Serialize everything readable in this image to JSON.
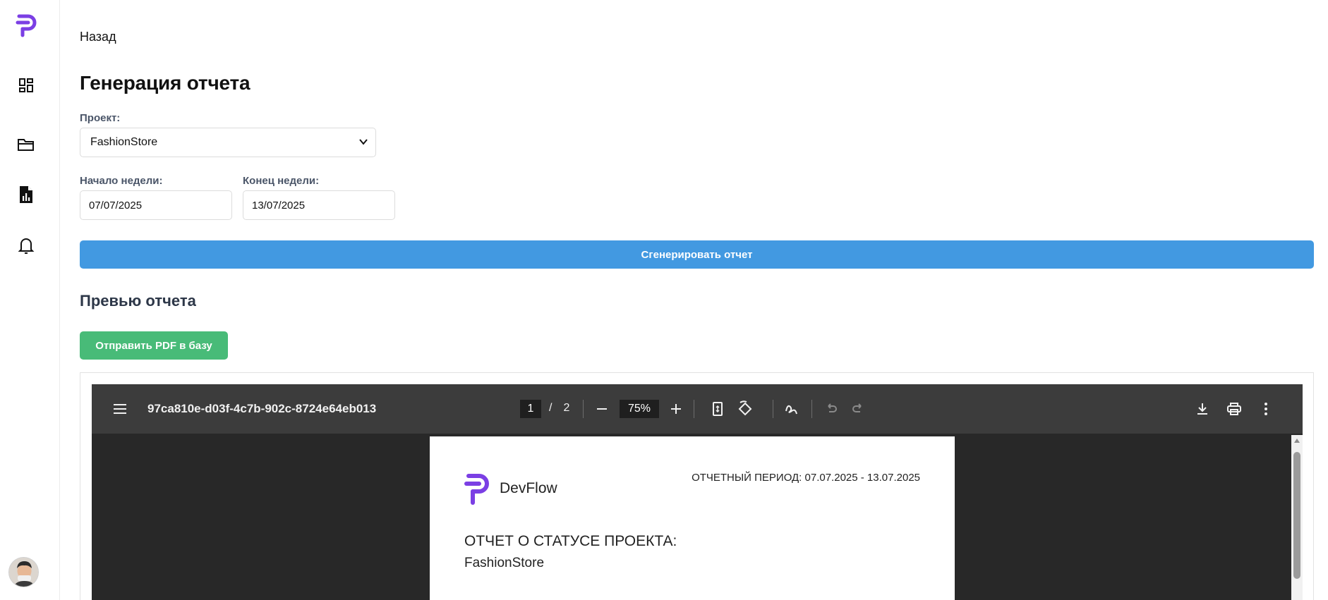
{
  "sidebar": {
    "items": [
      {
        "icon": "dashboard-icon"
      },
      {
        "icon": "folder-icon"
      },
      {
        "icon": "report-icon"
      },
      {
        "icon": "bell-icon"
      }
    ],
    "brand_color": "#7b3fe4"
  },
  "header": {
    "back_label": "Назад",
    "title": "Генерация отчета"
  },
  "form": {
    "project_label": "Проект:",
    "project_value": "FashionStore",
    "week_start_label": "Начало недели:",
    "week_start_value": "07/07/2025",
    "week_end_label": "Конец недели:",
    "week_end_value": "13/07/2025",
    "generate_label": "Сгенерировать отчет"
  },
  "preview": {
    "title": "Превью отчета",
    "send_label": "Отправить PDF в базу"
  },
  "pdf_viewer": {
    "filename": "97ca810e-d03f-4c7b-902c-8724e64eb013",
    "current_page": "1",
    "page_separator": "/",
    "total_pages": "2",
    "zoom": "75%"
  },
  "document": {
    "brand": "DevFlow",
    "period": "ОТЧЕТНЫЙ ПЕРИОД: 07.07.2025 - 13.07.2025",
    "heading": "ОТЧЕТ О СТАТУСЕ ПРОЕКТА:",
    "project": "FashionStore"
  },
  "colors": {
    "primary_button": "#4299e1",
    "success_button": "#48bb78",
    "viewer_toolbar": "#3c3c3c",
    "viewer_background": "#282828"
  }
}
